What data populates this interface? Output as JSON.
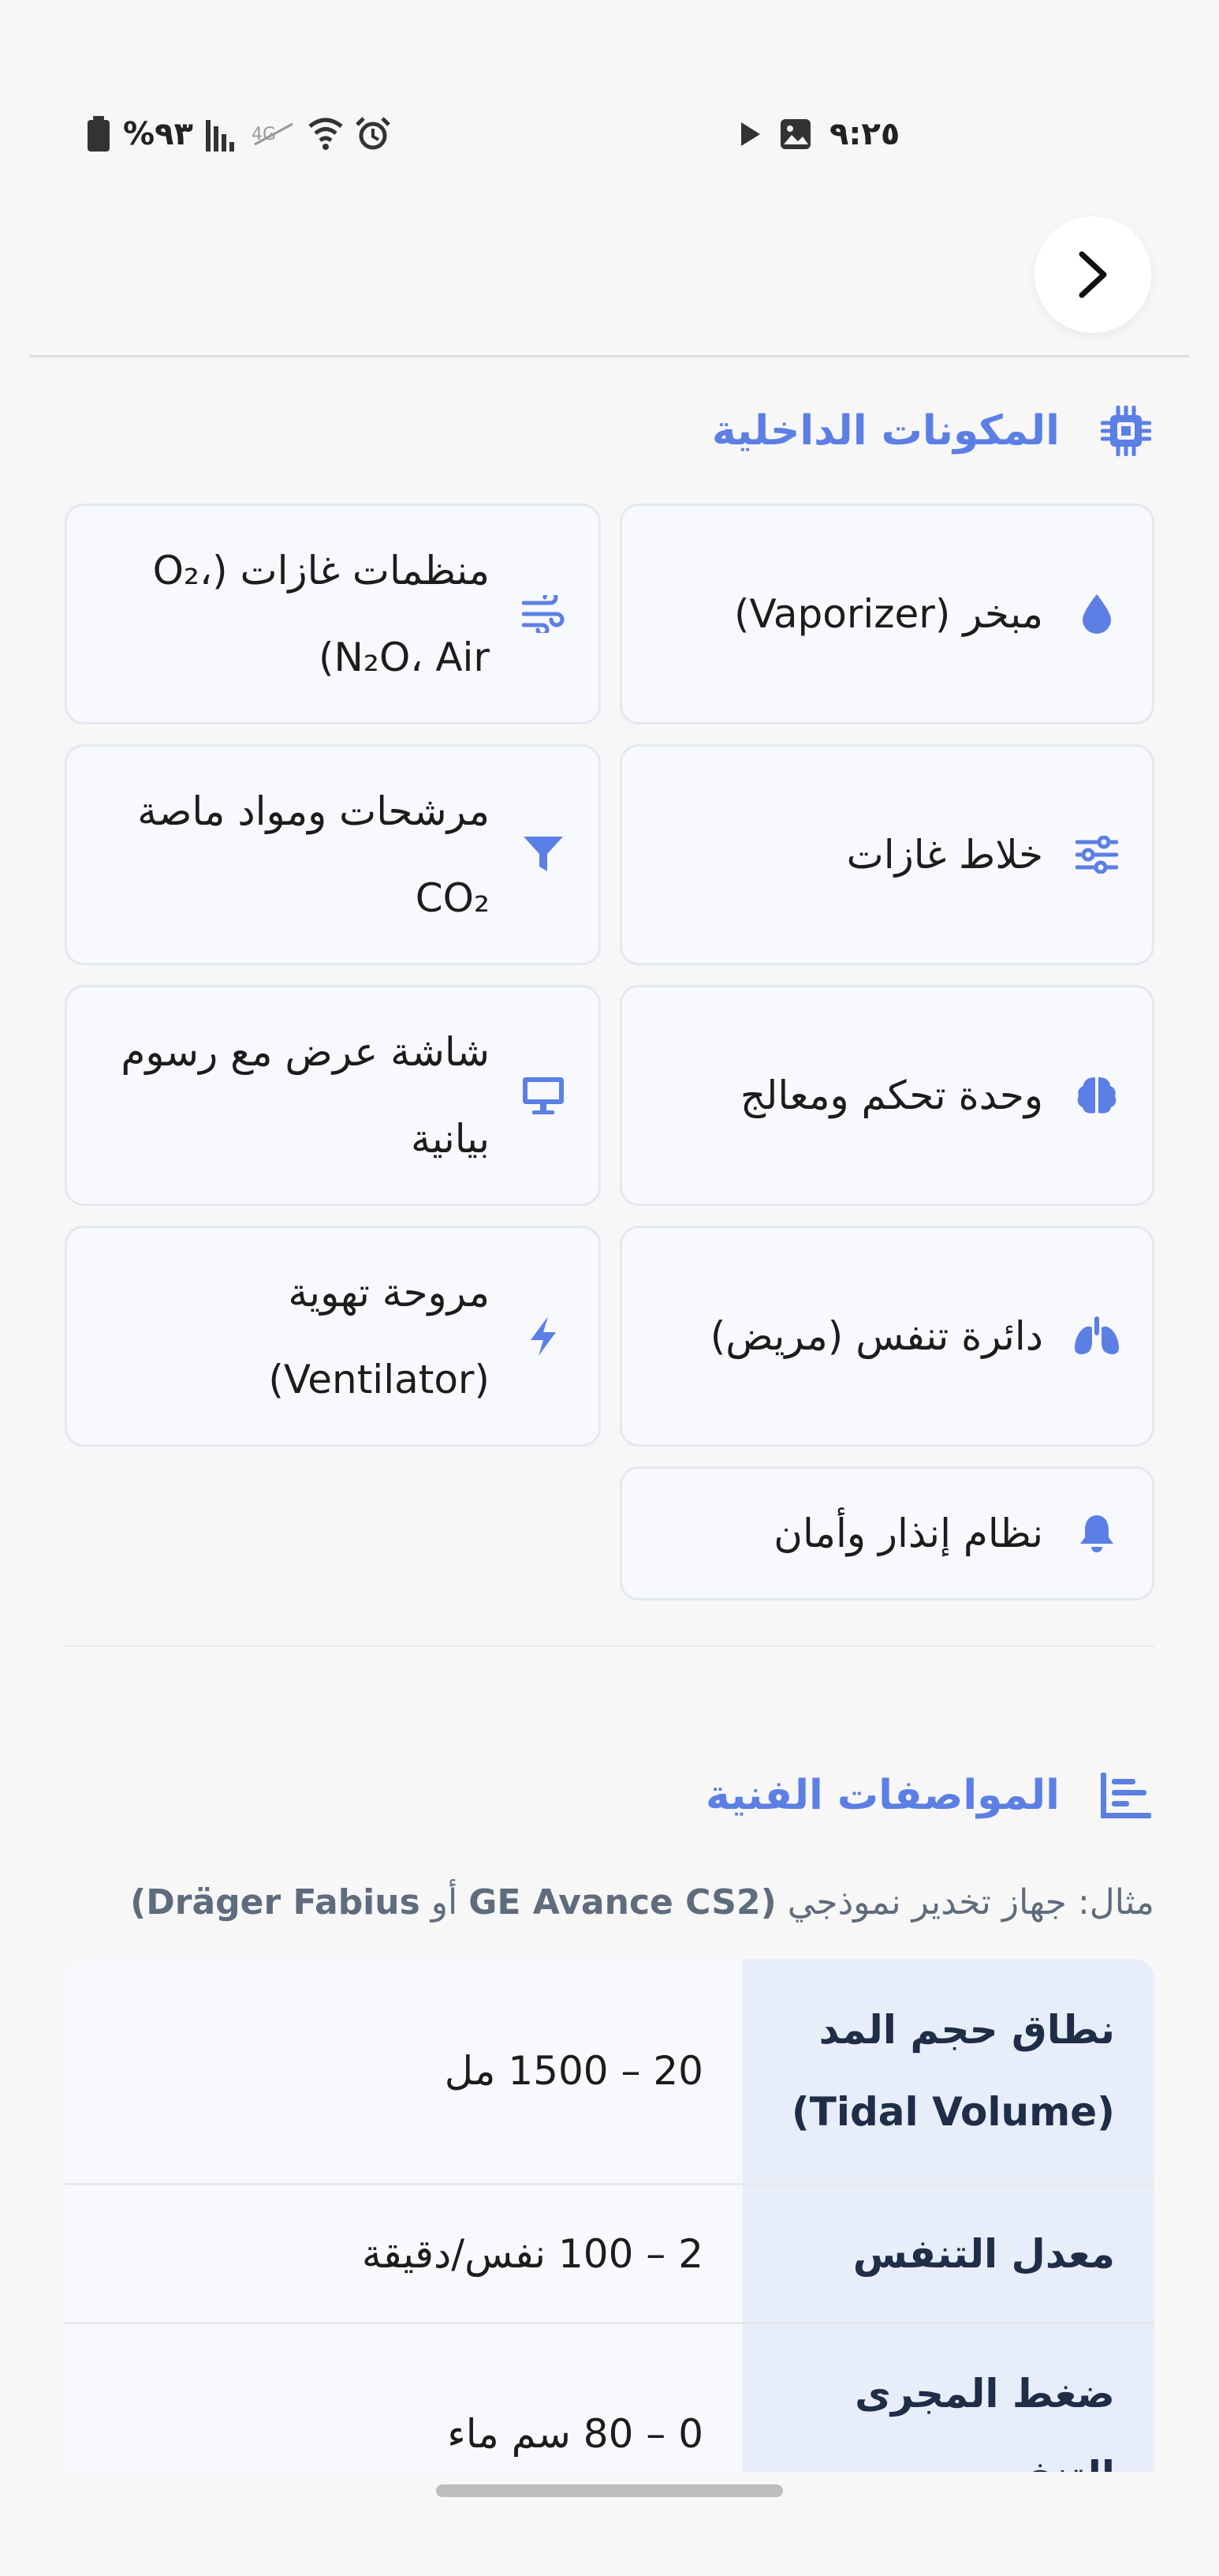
{
  "status_bar": {
    "time": "٩:٢٥",
    "battery": "%٩٣",
    "icons": [
      "battery-icon",
      "signal-icon",
      "signal-off-icon",
      "wifi-icon",
      "alarm-icon",
      "play-icon",
      "image-icon"
    ]
  },
  "header": {
    "forward_button_icon": "chevron-right-icon"
  },
  "components_section": {
    "title": "المكونات الداخلية",
    "icon": "chip-icon",
    "accent_color": "#5b7fe4",
    "items": [
      {
        "label": "مبخر (Vaporizer)",
        "icon": "droplet-icon"
      },
      {
        "label": "منظمات غازات (O₂، N₂O، Air)",
        "icon": "wind-icon"
      },
      {
        "label": "خلاط غازات",
        "icon": "sliders-icon"
      },
      {
        "label": "مرشحات ومواد ماصة CO₂",
        "icon": "filter-icon"
      },
      {
        "label": "وحدة تحكم ومعالج",
        "icon": "brain-icon"
      },
      {
        "label": "شاشة عرض مع رسوم بيانية",
        "icon": "monitor-icon"
      },
      {
        "label": "دائرة تنفس (مريض)",
        "icon": "lungs-icon"
      },
      {
        "label": "مروحة تهوية (Ventilator)",
        "icon": "bolt-icon"
      },
      {
        "label": "نظام إنذار وأمان",
        "icon": "bell-icon"
      }
    ]
  },
  "specs_section": {
    "title": "المواصفات الفنية",
    "icon": "bar-chart-icon",
    "subtitle_prefix": "مثال: جهاز تخدير نموذجي",
    "subtitle_model_a": "(GE Avance CS2",
    "subtitle_or": "أو",
    "subtitle_model_b": "Dräger Fabius)",
    "rows": [
      {
        "key": "نطاق حجم المد (Tidal Volume)",
        "value": "20 – 1500 مل"
      },
      {
        "key": "معدل التنفس",
        "value": "2 – 100 نفس/دقيقة"
      },
      {
        "key": "ضغط المجرى التنفسي",
        "value": "0 – 80 سم ماء"
      }
    ]
  }
}
